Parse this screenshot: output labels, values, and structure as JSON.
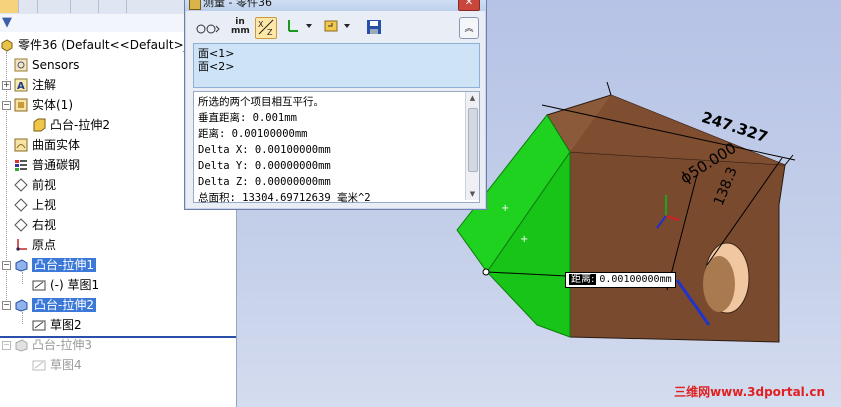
{
  "tree": {
    "root": "零件36  (Default<<Default>_P",
    "items": [
      {
        "label": "Sensors"
      },
      {
        "label": "注解"
      },
      {
        "label": "实体(1)"
      },
      {
        "label": "凸台-拉伸2"
      },
      {
        "label": "曲面实体"
      },
      {
        "label": "普通碳钢"
      },
      {
        "label": "前视"
      },
      {
        "label": "上视"
      },
      {
        "label": "右视"
      },
      {
        "label": "原点"
      },
      {
        "label": "凸台-拉伸1"
      },
      {
        "label": "(-) 草图1"
      },
      {
        "label": "凸台-拉伸2"
      },
      {
        "label": "草图2"
      },
      {
        "label": "凸台-拉伸3"
      },
      {
        "label": "草图4"
      }
    ]
  },
  "measure": {
    "title": "测量 - 零件36",
    "units_top": "in",
    "units_bottom": "mm",
    "close": "✕",
    "selections": [
      "面<1>",
      "面<2>"
    ],
    "results": [
      "所选的两个项目相互平行。",
      "垂直距离: 0.001mm",
      "距离: 0.00100000mm",
      "Delta X: 0.00100000mm",
      "Delta Y: 0.00000000mm",
      "Delta Z: 0.00000000mm",
      "总面积: 13304.69712639 毫米^2"
    ]
  },
  "graphics": {
    "callout_key": "距离:",
    "callout_value": "0.00100000mm",
    "dim_length": "247.327",
    "dim_diameter": "ϕ50.000",
    "dim_height": "138.3",
    "dim_small": "",
    "watermark": "三维网www.3dportal.cn"
  },
  "colors": {
    "selection": "#3b78d8",
    "face_green": "#1fd21f",
    "body_brown": "#7a4a2e",
    "viewport": "#c4cfe9"
  }
}
